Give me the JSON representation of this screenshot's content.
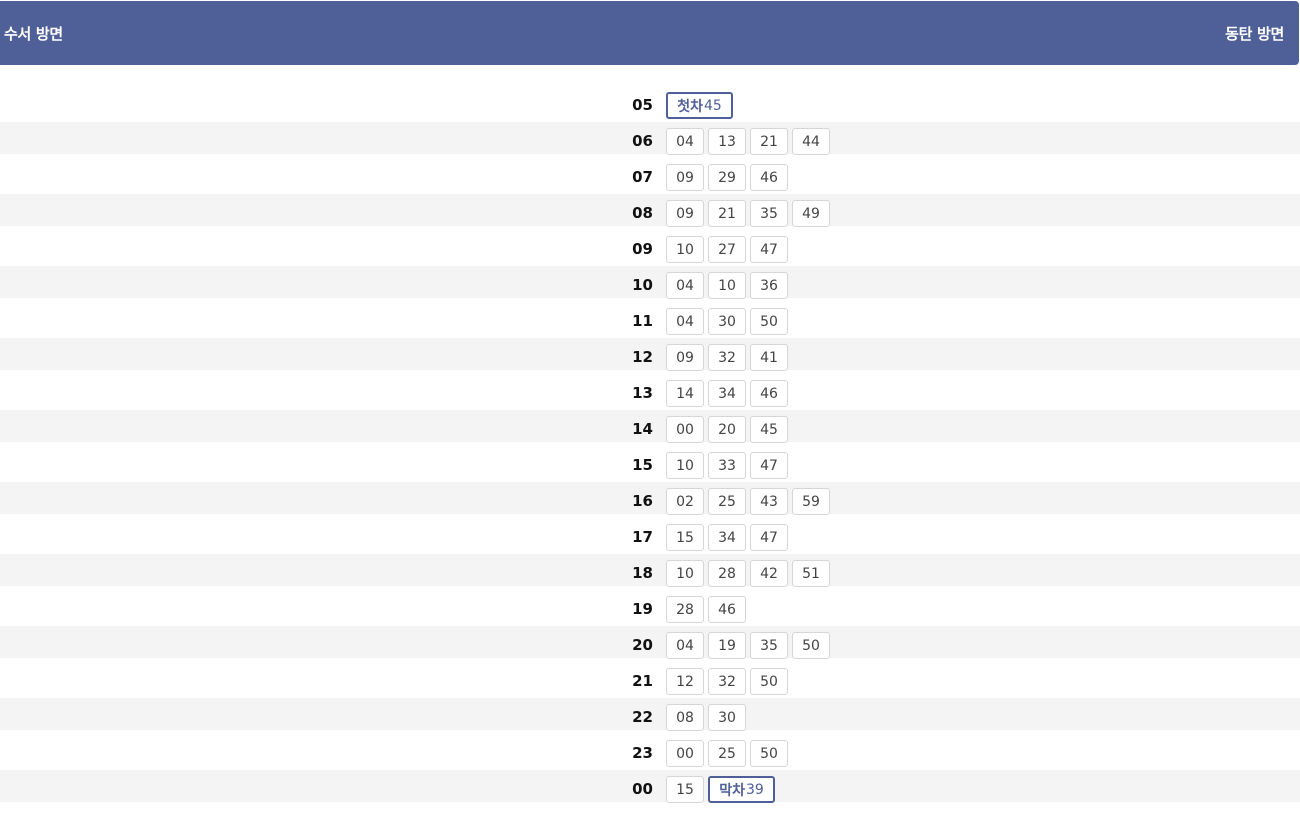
{
  "header": {
    "left_direction": "수서 방면",
    "right_direction": "동탄 방면"
  },
  "colors": {
    "accent": "#4f5f98",
    "row_alt": "#f4f4f4"
  },
  "schedule": [
    {
      "hour": "05",
      "minutes": [
        {
          "tag": "첫차",
          "value": "45"
        }
      ]
    },
    {
      "hour": "06",
      "minutes": [
        {
          "value": "04"
        },
        {
          "value": "13"
        },
        {
          "value": "21"
        },
        {
          "value": "44"
        }
      ]
    },
    {
      "hour": "07",
      "minutes": [
        {
          "value": "09"
        },
        {
          "value": "29"
        },
        {
          "value": "46"
        }
      ]
    },
    {
      "hour": "08",
      "minutes": [
        {
          "value": "09"
        },
        {
          "value": "21"
        },
        {
          "value": "35"
        },
        {
          "value": "49"
        }
      ]
    },
    {
      "hour": "09",
      "minutes": [
        {
          "value": "10"
        },
        {
          "value": "27"
        },
        {
          "value": "47"
        }
      ]
    },
    {
      "hour": "10",
      "minutes": [
        {
          "value": "04"
        },
        {
          "value": "10"
        },
        {
          "value": "36"
        }
      ]
    },
    {
      "hour": "11",
      "minutes": [
        {
          "value": "04"
        },
        {
          "value": "30"
        },
        {
          "value": "50"
        }
      ]
    },
    {
      "hour": "12",
      "minutes": [
        {
          "value": "09"
        },
        {
          "value": "32"
        },
        {
          "value": "41"
        }
      ]
    },
    {
      "hour": "13",
      "minutes": [
        {
          "value": "14"
        },
        {
          "value": "34"
        },
        {
          "value": "46"
        }
      ]
    },
    {
      "hour": "14",
      "minutes": [
        {
          "value": "00"
        },
        {
          "value": "20"
        },
        {
          "value": "45"
        }
      ]
    },
    {
      "hour": "15",
      "minutes": [
        {
          "value": "10"
        },
        {
          "value": "33"
        },
        {
          "value": "47"
        }
      ]
    },
    {
      "hour": "16",
      "minutes": [
        {
          "value": "02"
        },
        {
          "value": "25"
        },
        {
          "value": "43"
        },
        {
          "value": "59"
        }
      ]
    },
    {
      "hour": "17",
      "minutes": [
        {
          "value": "15"
        },
        {
          "value": "34"
        },
        {
          "value": "47"
        }
      ]
    },
    {
      "hour": "18",
      "minutes": [
        {
          "value": "10"
        },
        {
          "value": "28"
        },
        {
          "value": "42"
        },
        {
          "value": "51"
        }
      ]
    },
    {
      "hour": "19",
      "minutes": [
        {
          "value": "28"
        },
        {
          "value": "46"
        }
      ]
    },
    {
      "hour": "20",
      "minutes": [
        {
          "value": "04"
        },
        {
          "value": "19"
        },
        {
          "value": "35"
        },
        {
          "value": "50"
        }
      ]
    },
    {
      "hour": "21",
      "minutes": [
        {
          "value": "12"
        },
        {
          "value": "32"
        },
        {
          "value": "50"
        }
      ]
    },
    {
      "hour": "22",
      "minutes": [
        {
          "value": "08"
        },
        {
          "value": "30"
        }
      ]
    },
    {
      "hour": "23",
      "minutes": [
        {
          "value": "00"
        },
        {
          "value": "25"
        },
        {
          "value": "50"
        }
      ]
    },
    {
      "hour": "00",
      "minutes": [
        {
          "value": "15"
        },
        {
          "tag": "막차",
          "value": "39"
        }
      ]
    }
  ]
}
